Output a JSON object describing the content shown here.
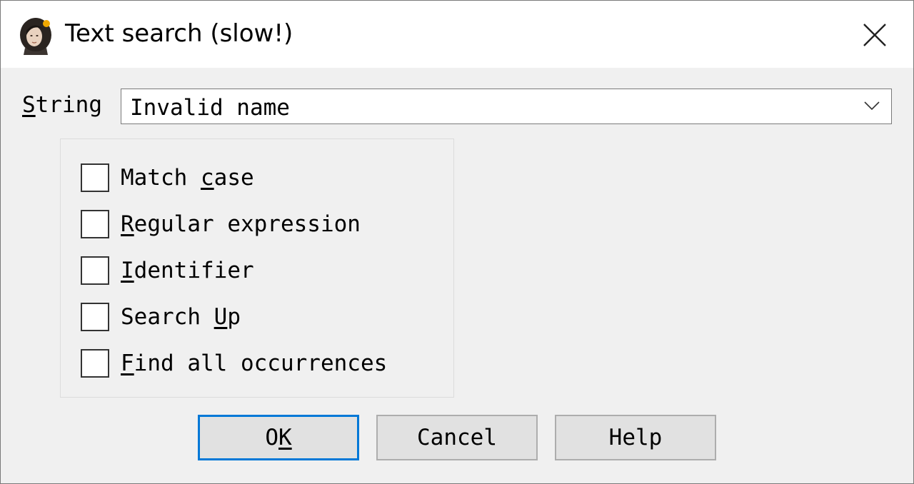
{
  "window": {
    "title": "Text search (slow!)",
    "icon": "portrait-app-icon",
    "close_icon": "close-icon"
  },
  "search": {
    "label_prefix": "",
    "label_mnemonic": "S",
    "label_rest": "tring",
    "value": "Invalid name"
  },
  "options": [
    {
      "before": "Match ",
      "mnemonic": "c",
      "after": "ase",
      "checked": false
    },
    {
      "before": "",
      "mnemonic": "R",
      "after": "egular expression",
      "checked": false
    },
    {
      "before": "",
      "mnemonic": "I",
      "after": "dentifier",
      "checked": false
    },
    {
      "before": "Search ",
      "mnemonic": "U",
      "after": "p",
      "checked": false
    },
    {
      "before": "",
      "mnemonic": "F",
      "after": "ind all occurrences",
      "checked": false
    }
  ],
  "buttons": {
    "ok": {
      "before": "O",
      "mnemonic": "K",
      "after": ""
    },
    "cancel": "Cancel",
    "help": "Help"
  },
  "colors": {
    "default_button_border": "#0078d7"
  }
}
